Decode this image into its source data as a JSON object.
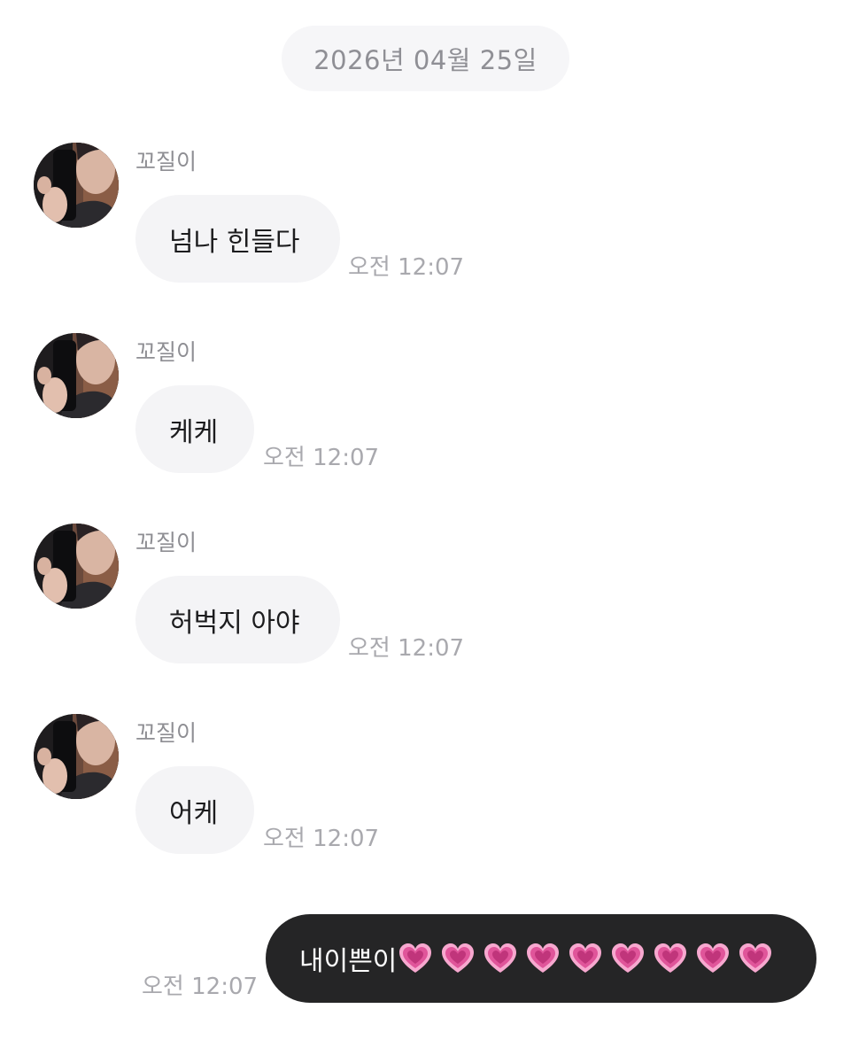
{
  "date_label": "2026년 04월 25일",
  "messages": [
    {
      "sender": "꼬질이",
      "text": "넘나 힌들다",
      "time": "오전 12:07"
    },
    {
      "sender": "꼬질이",
      "text": "케케",
      "time": "오전 12:07"
    },
    {
      "sender": "꼬질이",
      "text": "허벅지 아야",
      "time": "오전 12:07"
    },
    {
      "sender": "꼬질이",
      "text": "어케",
      "time": "오전 12:07"
    }
  ],
  "outgoing": {
    "text": "내이쁜이",
    "emoji": "growing-heart-emoji",
    "emoji_count": 9,
    "time": "오전 12:07"
  },
  "colors": {
    "background": "#ffffff",
    "incoming_bubble": "#f4f4f6",
    "outgoing_bubble": "#252526",
    "date_pill": "#f6f6f8",
    "secondary_text": "#8e8e93",
    "heart": "#e0559a"
  }
}
